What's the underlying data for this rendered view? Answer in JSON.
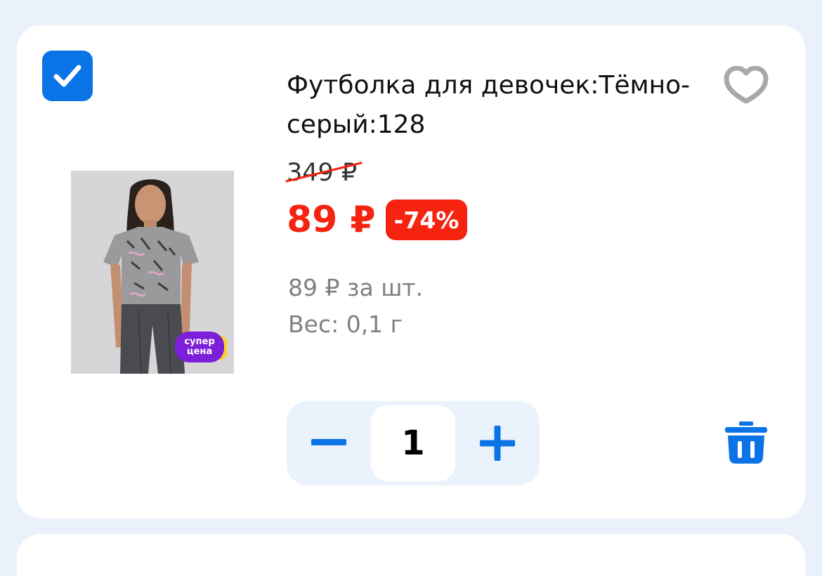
{
  "cart_item": {
    "selected": true,
    "title": "Футболка для девочек:Тёмно-серый:128",
    "old_price": "349 ₽",
    "price": "89 ₽",
    "discount": "-74%",
    "unit_price": "89 ₽ за шт.",
    "weight": "Вес: 0,1 г",
    "badge_line1": "супер",
    "badge_line2": "цена",
    "quantity": "1"
  },
  "colors": {
    "accent": "#0a73e6",
    "price_red": "#f5230f",
    "badge_purple": "#7b1fd8",
    "badge_yellow": "#ffd21f",
    "background": "#eaf1fb"
  },
  "icons": [
    "checkbox-checked-icon",
    "heart-icon",
    "minus-icon",
    "plus-icon",
    "trash-icon"
  ]
}
